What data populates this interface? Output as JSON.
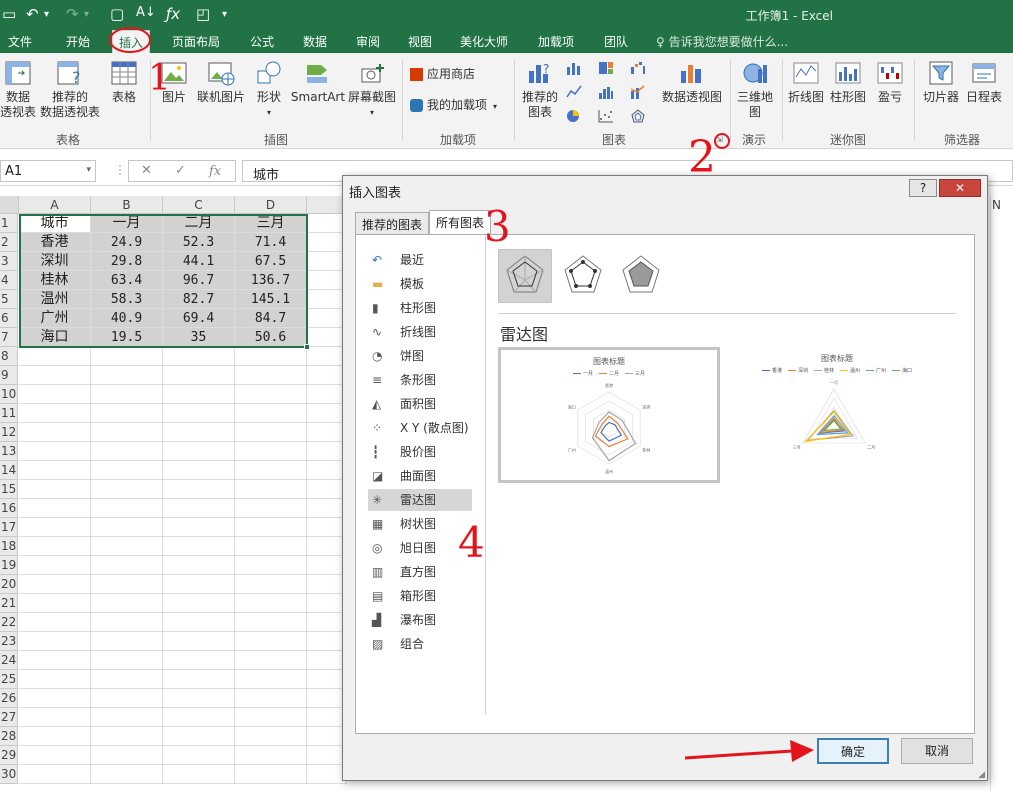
{
  "window": {
    "title": "工作簿1 - Excel"
  },
  "tabs": [
    {
      "label": "文件"
    },
    {
      "label": "开始"
    },
    {
      "label": "插入"
    },
    {
      "label": "页面布局"
    },
    {
      "label": "公式"
    },
    {
      "label": "数据"
    },
    {
      "label": "审阅"
    },
    {
      "label": "视图"
    },
    {
      "label": "美化大师"
    },
    {
      "label": "加载项"
    },
    {
      "label": "团队"
    }
  ],
  "tell_me": "♀ 告诉我您想要做什么...",
  "ribbon": {
    "buttons": {
      "pivot": "数据\n透视表",
      "rec_pivot": "推荐的\n数据透视表",
      "table": "表格",
      "picture": "图片",
      "online_picture": "联机图片",
      "shapes": "形状",
      "smartart": "SmartArt",
      "screenshot": "屏幕截图",
      "store": "应用商店",
      "my_addins": "我的加载项",
      "rec_charts": "推荐的\n图表",
      "pivot_chart": "数据透视图",
      "map3d": "三维地\n图",
      "spark_line": "折线图",
      "spark_col": "柱形图",
      "spark_wl": "盈亏",
      "slicer": "切片器",
      "timeline": "日程表"
    },
    "groups": {
      "tables": "表格",
      "illustrations": "插图",
      "addins": "加载项",
      "charts": "图表",
      "tours": "演示",
      "sparklines": "迷你图",
      "filters": "筛选器"
    }
  },
  "formula_bar": {
    "name_box": "A1",
    "fx": "fx",
    "value": "城市"
  },
  "sheet": {
    "columns": [
      "A",
      "B",
      "C",
      "D"
    ],
    "rows": [
      "1",
      "2",
      "3",
      "4",
      "5",
      "6",
      "7",
      "8",
      "9",
      "10",
      "11",
      "12",
      "13",
      "14",
      "15",
      "16",
      "17",
      "18",
      "19",
      "20",
      "21",
      "22",
      "23",
      "24",
      "25",
      "26",
      "27",
      "28",
      "29",
      "30"
    ],
    "header_row": [
      "城市",
      "一月",
      "二月",
      "三月"
    ],
    "data": [
      [
        "香港",
        "24.9",
        "52.3",
        "71.4"
      ],
      [
        "深圳",
        "29.8",
        "44.1",
        "67.5"
      ],
      [
        "桂林",
        "63.4",
        "96.7",
        "136.7"
      ],
      [
        "温州",
        "58.3",
        "82.7",
        "145.1"
      ],
      [
        "广州",
        "40.9",
        "69.4",
        "84.7"
      ],
      [
        "海口",
        "19.5",
        "35",
        "50.6"
      ]
    ],
    "col_n_label": "N"
  },
  "dialog": {
    "title": "插入图表",
    "help": "?",
    "close": "✕",
    "tabs": [
      "推荐的图表",
      "所有图表"
    ],
    "chart_types": [
      "最近",
      "模板",
      "柱形图",
      "折线图",
      "饼图",
      "条形图",
      "面积图",
      "X Y (散点图)",
      "股价图",
      "曲面图",
      "雷达图",
      "树状图",
      "旭日图",
      "直方图",
      "箱形图",
      "瀑布图",
      "组合"
    ],
    "selected_type": "雷达图",
    "chart_name": "雷达图",
    "preview_title": "图表标题",
    "preview1_legend": [
      "一月",
      "二月",
      "三月"
    ],
    "preview1_axes": [
      "香港",
      "深圳",
      "桂林",
      "温州",
      "广州",
      "海口"
    ],
    "preview2_legend": [
      "香港",
      "深圳",
      "桂林",
      "温州",
      "广州",
      "海口"
    ],
    "preview2_axes": [
      "一月",
      "二月",
      "三月"
    ],
    "ok": "确定",
    "cancel": "取消"
  },
  "annotations": [
    "1",
    "2",
    "3",
    "4"
  ],
  "colors": {
    "excel_green": "#217346",
    "annotation_red": "#e3141c",
    "series1": "#4472c4",
    "series2": "#ed7d31",
    "series3": "#a5a5a5",
    "series4": "#ffc000",
    "series5": "#5b9bd5",
    "series6": "#70ad47"
  }
}
